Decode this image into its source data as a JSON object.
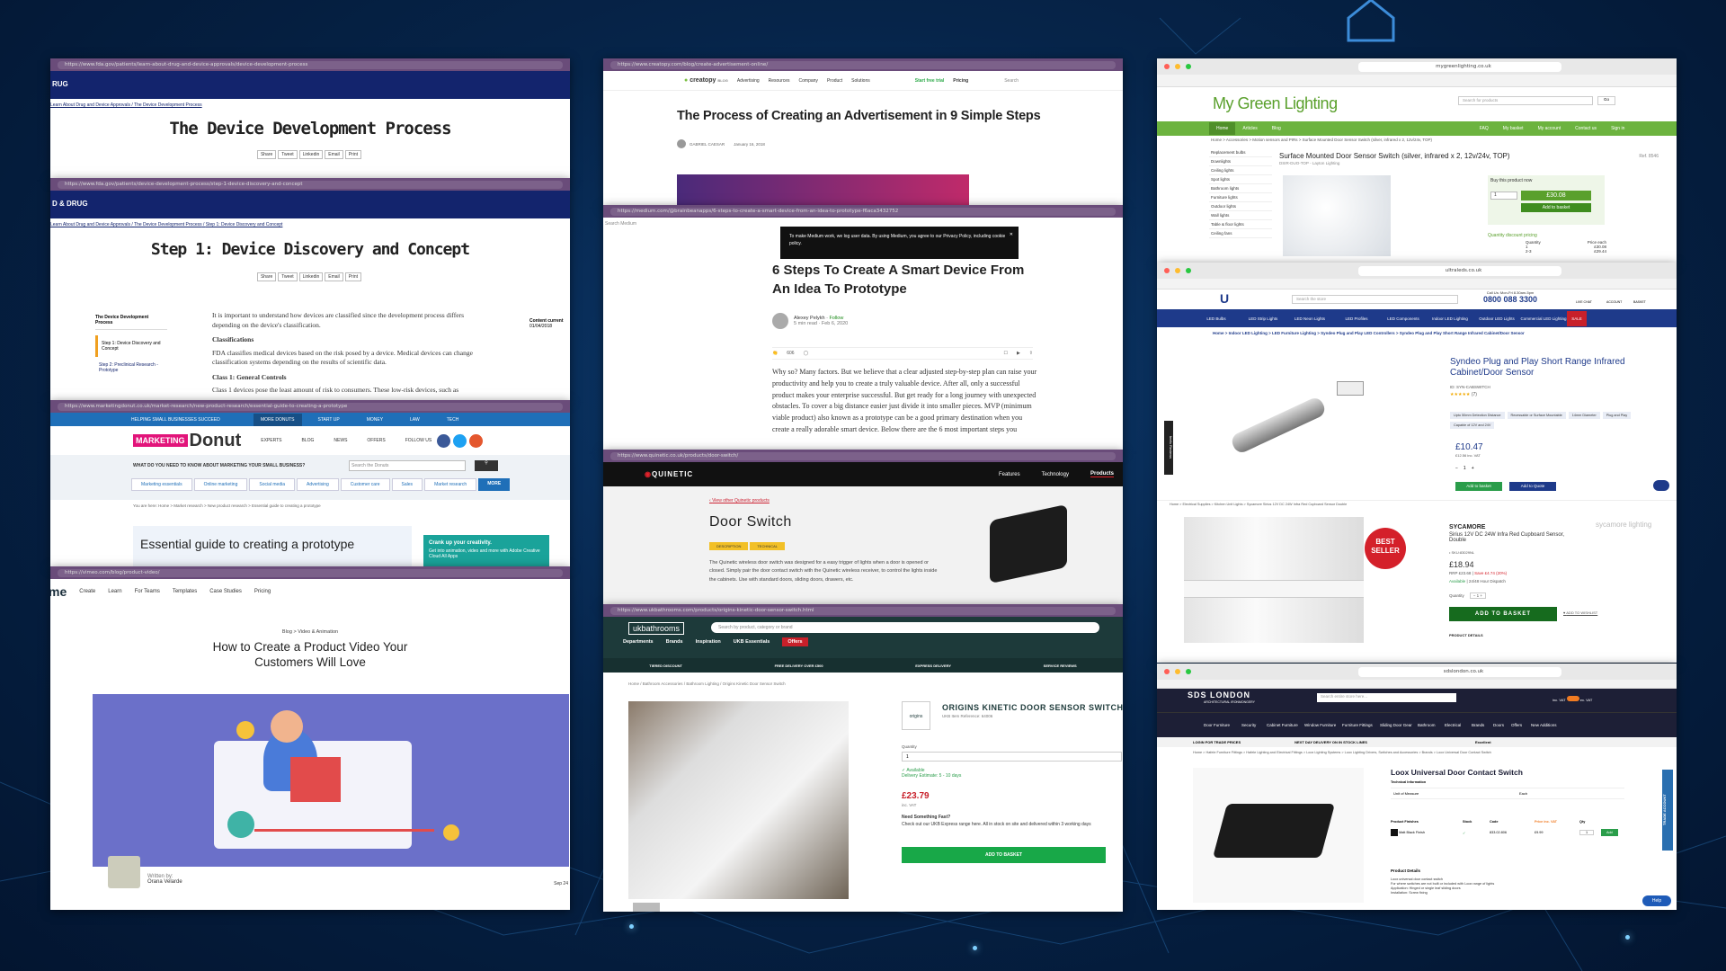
{
  "fda1": {
    "url": "https://www.fda.gov/patients/learn-about-drug-and-device-approvals/device-development-process",
    "brand": "RUG",
    "breadcrumb": [
      "Learn About Drug and Device Approvals",
      "The Device Development Process"
    ],
    "title": "The Device Development Process",
    "share": [
      "Share",
      "Tweet",
      "Linkedin",
      "Email",
      "Print"
    ]
  },
  "fda2": {
    "url": "https://www.fda.gov/patients/device-development-process/step-1-device-discovery-and-concept",
    "brand": "D & DRUG",
    "breadcrumb": [
      "Learn About Drug and Device Approvals",
      "The Device Development Process",
      "Step 1: Device Discovery and Concept"
    ],
    "title": "Step 1: Device Discovery and Concept",
    "share": [
      "Share",
      "Tweet",
      "Linkedin",
      "Email",
      "Print"
    ],
    "side_title": "The Device Development Process",
    "side_items": [
      "Step 1: Device Discovery and Concept",
      "Step 2: Preclinical Research - Prototype"
    ],
    "content_current": "Content current",
    "date": "01/04/2018",
    "intro": "It is important to understand how devices are classified since the development process differs depending on the device's classification.",
    "h_class": "Classifications",
    "p_class": "FDA classifies medical devices based on the risk posed by a device. Medical devices can change classification systems depending on the results of scientific data.",
    "h_general": "Class 1: General Controls",
    "p_general": "Class 1 devices pose the least amount of risk to consumers. These low-risk devices, such as"
  },
  "donut": {
    "url": "https://www.marketingdonut.co.uk/market-research/new-product-research/essential-guide-to-creating-a-prototype",
    "topbar": [
      "HELPING SMALL BUSINESSES SUCCEED",
      "MORE DONUTS",
      "START UP",
      "MONEY",
      "LAW",
      "TECH"
    ],
    "logo_a": "MARKETING",
    "logo_b": "Donut",
    "nav": [
      "EXPERTS",
      "BLOG",
      "NEWS",
      "OFFERS",
      "FOLLOW US"
    ],
    "question": "WHAT DO YOU NEED TO KNOW ABOUT MARKETING YOUR SMALL BUSINESS?",
    "search_placeholder": "Search the Donuts",
    "tabs": [
      "Marketing essentials",
      "Online marketing",
      "Social media",
      "Advertising",
      "Customer care",
      "Sales",
      "Market research",
      "MORE"
    ],
    "crumb": "You are here: Home > Market research > New product research > Essential guide to creating a prototype",
    "title": "Essential guide to creating a prototype",
    "ad_title": "Crank up your creativity.",
    "ad_text": "Get into animation, video and more with Adobe Creative Cloud All Apps"
  },
  "vimeo": {
    "url": "https://vimeo.com/blog/product-video/",
    "logo": "me",
    "nav": [
      "Create",
      "Learn",
      "For Teams",
      "Templates",
      "Case Studies",
      "Pricing"
    ],
    "crumb": [
      "Blog",
      "Video & Animation"
    ],
    "title": "How to Create a Product Video Your Customers Will Love",
    "written_by": "Written by:",
    "author": "Orana Velarde",
    "date": "Sep 24"
  },
  "creatopy": {
    "url": "https://www.creatopy.com/blog/create-advertisement-online/",
    "logo": "creatopy",
    "blog": "BLOG",
    "nav": [
      "Advertising",
      "Resources",
      "Company",
      "Product",
      "Solutions"
    ],
    "cta": "Start free trial",
    "pricing": "Pricing",
    "search": "Search",
    "title": "The Process of Creating an Advertisement in 9 Simple Steps",
    "author": "GABRIEL CAESAR",
    "date": "January 16, 2018"
  },
  "medium": {
    "url": "https://medium.com/@brainbeanapps/6-steps-to-create-a-smart-device-from-an-idea-to-prototype-f6aca3432752",
    "search": "Search Medium",
    "cookie": "To make Medium work, we log user data. By using Medium, you agree to our Privacy Policy, including cookie policy.",
    "title": "6 Steps To Create A Smart Device From An Idea To Prototype",
    "author": "Alexey Pelykh",
    "follow": "Follow",
    "meta": "5 min read · Feb 6, 2020",
    "claps": "606",
    "body": "Why so? Many factors. But we believe that a clear adjusted step-by-step plan can raise your productivity and help you to create a truly valuable device. After all, only a successful product makes your enterprise successful. But get ready for a long journey with unexpected obstacles. To cover a big distance easier just divide it into smaller pieces. MVP (minimum viable product) also known as a prototype can be a good primary destination when you create a really adorable smart device. Below there are the 6 most important steps you"
  },
  "quinetic": {
    "url": "https://www.quinetic.co.uk/products/door-switch/",
    "logo": "QUINETIC",
    "nav": [
      "Features",
      "Technology",
      "Products"
    ],
    "back": "View other Quinetic products",
    "title": "Door Switch",
    "tabs": [
      "DESCRIPTION",
      "TECHNICAL"
    ],
    "desc": "The Quinetic wireless door switch was designed for a easy trigger of lights when a door is opened or closed. Simply pair the door contact switch with the Quinetic wireless receiver, to control the lights inside the cabinets. Use with standard doors, sliding doors, drawers, etc."
  },
  "ukb": {
    "url": "https://www.ukbathrooms.com/products/origins-kinetic-door-sensor-switch.html",
    "logo": "ukbathrooms",
    "search": "Search by product, category or brand",
    "nav": [
      "Departments",
      "Brands",
      "Inspiration",
      "UKB Essentials",
      "Offers"
    ],
    "usps": [
      "TIERED DISCOUNT",
      "FREE DELIVERY OVER £500",
      "EXPRESS DELIVERY",
      "SERVICE REVIEWS"
    ],
    "crumb": [
      "Home",
      "Bathroom Accessories",
      "Bathroom Lighting",
      "Origins Kinetic Door Sensor Switch"
    ],
    "brand": "origins",
    "title": "ORIGINS KINETIC DOOR SENSOR SWITCH",
    "item": "UKB Item Reference: 64006",
    "qty_label": "Quantity",
    "qty": "1",
    "available": "Available",
    "delivery": "Delivery Estimate: 5 - 10 days",
    "price": "£23.79",
    "vat": "inc. VAT",
    "fast": "Need Something Fast?",
    "fast_text": "Check out our UKB Express range here. All in stock on site and delivered within 3 working days",
    "cta": "ADD TO BASKET"
  },
  "mgl": {
    "url": "mygreenlighting.co.uk",
    "logo": "My Green Lighting",
    "search": "Search for products",
    "go": "Go",
    "nav": [
      "Home",
      "Articles",
      "Blog",
      "FAQ",
      "My basket",
      "My account",
      "Contact us",
      "Sign in"
    ],
    "crumb": "Home > Accessories > Motion sensors and PIRs > Surface Mounted Door Sensor Switch (silver, infrared x 2, 12v/24v, TOP)",
    "side": [
      "Replacement bulbs",
      "Downlights",
      "Ceiling lights",
      "Spot lights",
      "Bathroom lights",
      "Furniture lights",
      "Outdoor lights",
      "Wall lights",
      "Table & floor lights",
      "Ceiling fans"
    ],
    "title": "Surface Mounted Door Sensor Switch (silver, infrared x 2, 12v/24v, TOP)",
    "sku": "DSIR-DUO-TOP - Layton Lighting",
    "ref": "Ref. 8546",
    "buy": "Buy this product now",
    "qty": "1",
    "price": "£30.08",
    "cta": "Add to basket",
    "qd": "Quantity discount pricing",
    "qd_head": [
      "Quantity",
      "Price each"
    ],
    "qd_rows": [
      [
        "1",
        "£30.08"
      ],
      [
        "2-3",
        "£29.44"
      ]
    ]
  },
  "ultra": {
    "url": "ultraleds.co.uk",
    "search": "Search the store",
    "phone_label": "Call Us: Mon-Fri 8.30am-5pm",
    "phone": "0800 088 3300",
    "chat": "LIVE CHAT",
    "account": "ACCOUNT",
    "basket": "BASKET",
    "nav": [
      "LED Bulbs",
      "LED Strip Lights",
      "LED Neon Lights",
      "LED Profiles",
      "LED Components",
      "Indoor LED Lighting",
      "Outdoor LED Lights",
      "Commercial LED Lighting",
      "SALE"
    ],
    "crumb": "Home > Indoor LED Lighting > LED Furniture Lighting > Syndeo Plug and Play LED Controllers > Syndeo Plug and Play Short Range Infrared Cabinet/Door Sensor",
    "title": "Syndeo Plug and Play Short Range Infrared Cabinet/Door Sensor",
    "sku": "ID: SYN-CABSWITCH",
    "reviews": "(7)",
    "tags": [
      "Upto 50mm Detection Distance",
      "Recessable or Surface Mountable",
      "14mm Diameter",
      "Plug and Play",
      "Capable of 12V and 24V"
    ],
    "price": "£10.47",
    "price_ex": "£12.56 inc. VAT",
    "qty": "1",
    "btn1": "Add to basket",
    "btn2": "Add to Quote",
    "feefo": "feefo Reviews"
  },
  "sycamore": {
    "crumb": "Home > Electrical Supplies > Kitchen Unit Lights > Sycamore Sirius 12V DC 24W Infra Red Cupboard Sensor Double",
    "badge_a": "BEST",
    "badge_b": "SELLER",
    "brand": "SYCAMORE",
    "title": "Sirius 12V DC 24W Infra Red Cupboard Sensor, Double",
    "sku": "• SKU:83029NL",
    "logo": "sycamore lighting",
    "price": "£18.94",
    "rrp": "RRP £23.68",
    "save": "Save £4.74 (20%)",
    "avail": "Available",
    "dispatch": "24/48 Hour Dispatch",
    "qty_label": "Quantity",
    "qty": "1",
    "cta": "ADD TO BASKET",
    "wish": "ADD TO WISHLIST",
    "details": "PRODUCT DETAILS"
  },
  "sds": {
    "url": "sdslondon.co.uk",
    "logo": "SDS LONDON",
    "sub": "ARCHITECTURAL IRONMONGERY",
    "search": "Search entire store here...",
    "vat": [
      "inc. VAT",
      "ex. VAT"
    ],
    "nav": [
      "Door Furniture",
      "Security",
      "Cabinet Furniture",
      "Window Furniture",
      "Furniture Fittings",
      "Sliding Door Gear",
      "Bathroom",
      "Electrical",
      "Brands",
      "Doors",
      "Offers",
      "New Additions"
    ],
    "bar": [
      "LOGIN FOR TRADE PRICES",
      "NEXT DAY DELIVERY ON IN STOCK LINES",
      "Excellent"
    ],
    "crumb": "Home > Hafele Furniture Fittings > Hafele Lighting and Electrical Fittings > Loox Lighting Systems > Loox Lighting Drivers, Switches and Accessories > Brands > Loox Universal Door Contact Switch",
    "title": "Loox Universal Door Contact Switch",
    "tech": "Technical Information",
    "uom": [
      "Unit of Measure",
      "Each"
    ],
    "cols": [
      "Product Finishes",
      "Stock",
      "Code",
      "Price inc. VAT",
      "Qty"
    ],
    "row": [
      "Matt Black Finish",
      "✓",
      "833.02.806",
      "£9.99",
      "1"
    ],
    "add": "Add",
    "details": "Product Details",
    "d_lines": [
      "Loox universal door contact switch",
      "For where switches are not built or included with Loox range of lights",
      "Application: Hinged or single leaf sliding doors",
      "Installation: Screw fixing"
    ],
    "trade": "TRADE ACCOUNT",
    "help": "Help"
  }
}
